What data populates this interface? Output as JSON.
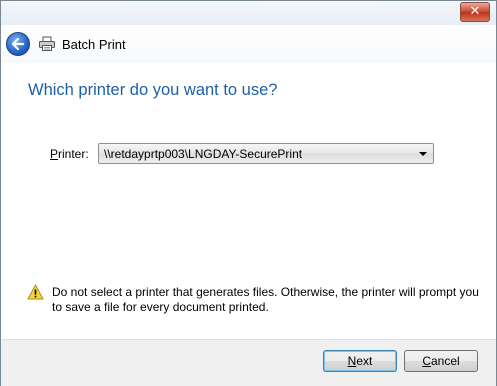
{
  "window": {
    "close_symbol": "✕"
  },
  "header": {
    "title": "Batch Print",
    "back_icon": "back-arrow-icon",
    "app_icon": "printer-icon"
  },
  "page": {
    "heading": "Which printer do you want to use?"
  },
  "printer": {
    "label_accesskey": "P",
    "label_rest": "rinter:",
    "selected": "\\\\retdayprtp003\\LNGDAY-SecurePrint"
  },
  "warning": {
    "icon": "warning-icon",
    "text": "Do not select a printer that generates files.  Otherwise, the printer will prompt you to save a file for every document printed."
  },
  "buttons": {
    "next_accesskey": "N",
    "next_rest": "ext",
    "cancel_accesskey": "C",
    "cancel_rest": "ancel"
  },
  "colors": {
    "heading": "#1e5fa8",
    "close_button": "#c9442c",
    "footer_bg": "#f0f0f0"
  }
}
